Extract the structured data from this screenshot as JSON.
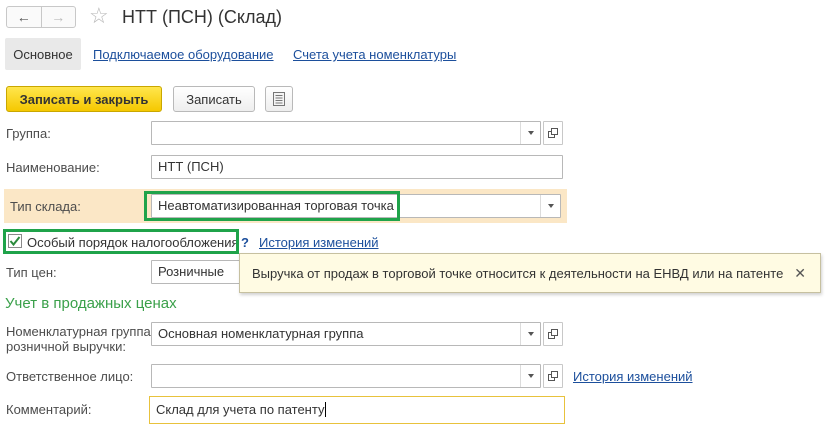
{
  "header": {
    "back_icon": "arrow-left-icon",
    "forward_icon": "arrow-right-icon",
    "favorite_icon": "star-icon",
    "title": "НТТ (ПСН) (Склад)"
  },
  "tabs": [
    {
      "label": "Основное",
      "active": true
    },
    {
      "label": "Подключаемое оборудование",
      "active": false
    },
    {
      "label": "Счета учета номенклатуры",
      "active": false
    }
  ],
  "toolbar": {
    "save_close_label": "Записать и закрыть",
    "save_label": "Записать",
    "menu_icon": "list-icon"
  },
  "form": {
    "group": {
      "label": "Группа:",
      "value": ""
    },
    "name": {
      "label": "Наименование:",
      "value": "НТТ (ПСН)"
    },
    "warehouse_type": {
      "label": "Тип склада:",
      "value": "Неавтоматизированная торговая точка"
    },
    "special_taxation": {
      "label": "Особый порядок налогообложения",
      "checked": true,
      "help": "?",
      "history_link": "История изменений"
    },
    "price_type": {
      "label": "Тип цен:",
      "value": "Розничные"
    },
    "section_title": "Учет в продажных ценах",
    "nomenclature_group": {
      "label_line1": "Номенклатурная группа",
      "label_line2": "розничной выручки:",
      "value": "Основная номенклатурная группа"
    },
    "responsible": {
      "label": "Ответственное лицо:",
      "value": "",
      "history_link": "История изменений"
    },
    "comment": {
      "label": "Комментарий:",
      "value": "Склад для учета по патенту"
    }
  },
  "tooltip": {
    "text": "Выручка от продаж в торговой точке относится к деятельности на ЕНВД или на патенте",
    "close_icon": "close-icon"
  },
  "colors": {
    "primary_button": "#f5c800",
    "link": "#1c4f9c",
    "highlight_row": "#fbe7c6",
    "annotation_box": "#1fa34a",
    "section_title": "#3aa04a",
    "tooltip_bg": "#fffbe3"
  }
}
